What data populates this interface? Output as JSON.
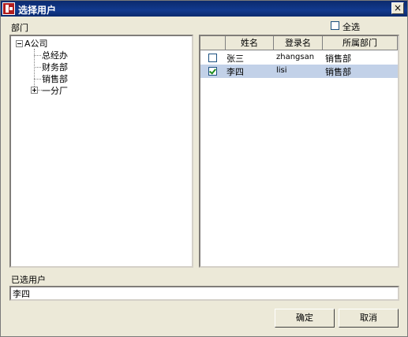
{
  "window": {
    "title": "选择用户",
    "close_glyph": "×"
  },
  "dept": {
    "label": "部门"
  },
  "select_all": {
    "label": "全选"
  },
  "tree": {
    "root": {
      "label": "A公司",
      "expander": "minus"
    },
    "children": [
      {
        "label": "总经办"
      },
      {
        "label": "财务部"
      },
      {
        "label": "销售部"
      },
      {
        "label": "一分厂",
        "expander": "plus"
      }
    ]
  },
  "list": {
    "columns": [
      "",
      "姓名",
      "登录名",
      "所属部门"
    ],
    "rows": [
      {
        "checked": false,
        "name": "张三",
        "login": "zhangsan",
        "dept": "销售部"
      },
      {
        "checked": true,
        "name": "李四",
        "login": "lisi",
        "dept": "销售部"
      }
    ]
  },
  "selected": {
    "label": "已选用户",
    "value": "李四"
  },
  "buttons": {
    "ok": "确定",
    "cancel": "取消"
  },
  "colors": {
    "title_bar": "#0b2a6d",
    "selected_row": "#c2d1e8",
    "dialog_bg": "#ece9d8"
  },
  "icons": {
    "app": "app-logo-icon",
    "close": "close-icon",
    "expand": "tree-expander-icon",
    "check": "checkbox-icon"
  }
}
